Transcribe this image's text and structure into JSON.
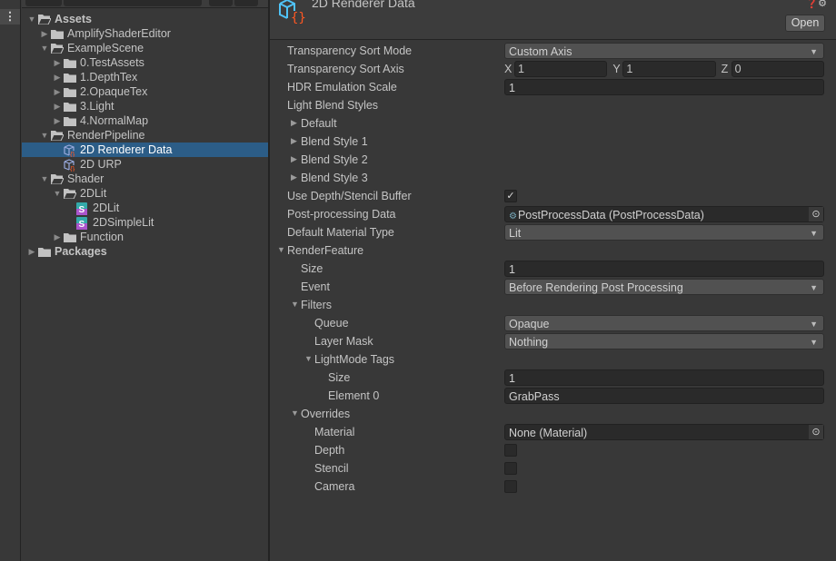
{
  "colors": {
    "selection": "#2c5d87",
    "field": "#2a2a2a",
    "dropdown": "#515151",
    "panel": "#383838"
  },
  "tree": [
    {
      "label": "Assets",
      "level": 0,
      "arrow": "down",
      "icon": "folder-open-icon",
      "bold": true
    },
    {
      "label": "AmplifyShaderEditor",
      "level": 1,
      "arrow": "right",
      "icon": "folder-icon"
    },
    {
      "label": "ExampleScene",
      "level": 1,
      "arrow": "down",
      "icon": "folder-open-icon"
    },
    {
      "label": "0.TestAssets",
      "level": 2,
      "arrow": "right",
      "icon": "folder-icon"
    },
    {
      "label": "1.DepthTex",
      "level": 2,
      "arrow": "right",
      "icon": "folder-icon"
    },
    {
      "label": "2.OpaqueTex",
      "level": 2,
      "arrow": "right",
      "icon": "folder-icon"
    },
    {
      "label": "3.Light",
      "level": 2,
      "arrow": "right",
      "icon": "folder-icon"
    },
    {
      "label": "4.NormalMap",
      "level": 2,
      "arrow": "right",
      "icon": "folder-icon"
    },
    {
      "label": "RenderPipeline",
      "level": 1,
      "arrow": "down",
      "icon": "folder-open-icon"
    },
    {
      "label": "2D Renderer Data",
      "level": 2,
      "arrow": "",
      "icon": "renderer-data-icon",
      "selected": true
    },
    {
      "label": "2D URP",
      "level": 2,
      "arrow": "",
      "icon": "pipeline-asset-icon"
    },
    {
      "label": "Shader",
      "level": 1,
      "arrow": "down",
      "icon": "folder-open-icon"
    },
    {
      "label": "2DLit",
      "level": 2,
      "arrow": "down",
      "icon": "folder-open-icon"
    },
    {
      "label": "2DLit",
      "level": 3,
      "arrow": "",
      "icon": "shader-icon"
    },
    {
      "label": "2DSimpleLit",
      "level": 3,
      "arrow": "",
      "icon": "shader-icon"
    },
    {
      "label": "Function",
      "level": 2,
      "arrow": "right",
      "icon": "folder-icon"
    },
    {
      "label": "Packages",
      "level": 0,
      "arrow": "right",
      "icon": "folder-icon",
      "bold": true
    }
  ],
  "inspector": {
    "title": "2D Renderer Data",
    "open_label": "Open",
    "rows": [
      {
        "label": "Transparency Sort Mode",
        "level": 0,
        "type": "dropdown",
        "value": "Custom Axis"
      },
      {
        "label": "Transparency Sort Axis",
        "level": 0,
        "type": "vector3",
        "x": "1",
        "y": "1",
        "z": "0",
        "axes": [
          "X",
          "Y",
          "Z"
        ]
      },
      {
        "label": "HDR Emulation Scale",
        "level": 0,
        "type": "text",
        "value": "1"
      },
      {
        "label": "Light Blend Styles",
        "level": 0,
        "type": "label"
      },
      {
        "label": "Default",
        "level": 1,
        "type": "foldout",
        "open": false
      },
      {
        "label": "Blend Style 1",
        "level": 1,
        "type": "foldout",
        "open": false
      },
      {
        "label": "Blend Style 2",
        "level": 1,
        "type": "foldout",
        "open": false
      },
      {
        "label": "Blend Style 3",
        "level": 1,
        "type": "foldout",
        "open": false
      },
      {
        "label": "Use Depth/Stencil Buffer",
        "level": 0,
        "type": "checkbox",
        "checked": true
      },
      {
        "label": "Post-processing Data",
        "level": 0,
        "type": "object",
        "value": "PostProcessData (PostProcessData)",
        "icon": "post-process-data-icon"
      },
      {
        "label": "Default Material Type",
        "level": 0,
        "type": "dropdown",
        "value": "Lit"
      },
      {
        "label": "RenderFeature",
        "level": 0,
        "type": "foldout",
        "open": true
      },
      {
        "label": "Size",
        "level": 1,
        "type": "text",
        "value": "1"
      },
      {
        "label": "Event",
        "level": 1,
        "type": "dropdown",
        "value": "Before Rendering Post Processing"
      },
      {
        "label": "Filters",
        "level": 1,
        "type": "foldout",
        "open": true
      },
      {
        "label": "Queue",
        "level": 2,
        "type": "dropdown",
        "value": "Opaque"
      },
      {
        "label": "Layer Mask",
        "level": 2,
        "type": "dropdown",
        "value": "Nothing"
      },
      {
        "label": "LightMode Tags",
        "level": 2,
        "type": "foldout",
        "open": true
      },
      {
        "label": "Size",
        "level": 3,
        "type": "text",
        "value": "1"
      },
      {
        "label": "Element 0",
        "level": 3,
        "type": "text",
        "value": "GrabPass"
      },
      {
        "label": "Overrides",
        "level": 1,
        "type": "foldout",
        "open": true
      },
      {
        "label": "Material",
        "level": 2,
        "type": "object",
        "value": "None (Material)"
      },
      {
        "label": "Depth",
        "level": 2,
        "type": "checkbox",
        "checked": false
      },
      {
        "label": "Stencil",
        "level": 2,
        "type": "checkbox",
        "checked": false
      },
      {
        "label": "Camera",
        "level": 2,
        "type": "checkbox",
        "checked": false
      }
    ]
  }
}
